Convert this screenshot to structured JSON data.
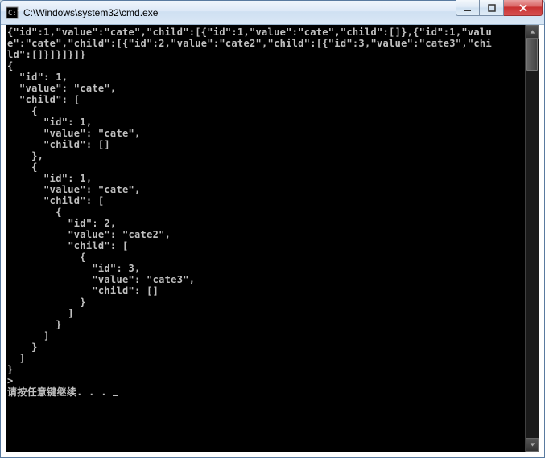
{
  "window": {
    "title": "C:\\Windows\\system32\\cmd.exe"
  },
  "console": {
    "lines": [
      "{\"id\":1,\"value\":\"cate\",\"child\":[{\"id\":1,\"value\":\"cate\",\"child\":[]},{\"id\":1,\"valu",
      "e\":\"cate\",\"child\":[{\"id\":2,\"value\":\"cate2\",\"child\":[{\"id\":3,\"value\":\"cate3\",\"chi",
      "ld\":[]}]}]}]}",
      "{",
      "  \"id\": 1,",
      "  \"value\": \"cate\",",
      "  \"child\": [",
      "    {",
      "      \"id\": 1,",
      "      \"value\": \"cate\",",
      "      \"child\": []",
      "    },",
      "    {",
      "      \"id\": 1,",
      "      \"value\": \"cate\",",
      "      \"child\": [",
      "        {",
      "          \"id\": 2,",
      "          \"value\": \"cate2\",",
      "          \"child\": [",
      "            {",
      "              \"id\": 3,",
      "              \"value\": \"cate3\",",
      "              \"child\": []",
      "            }",
      "          ]",
      "        }",
      "      ]",
      "    }",
      "  ]",
      "}",
      ">",
      "请按任意键继续. . . "
    ]
  }
}
